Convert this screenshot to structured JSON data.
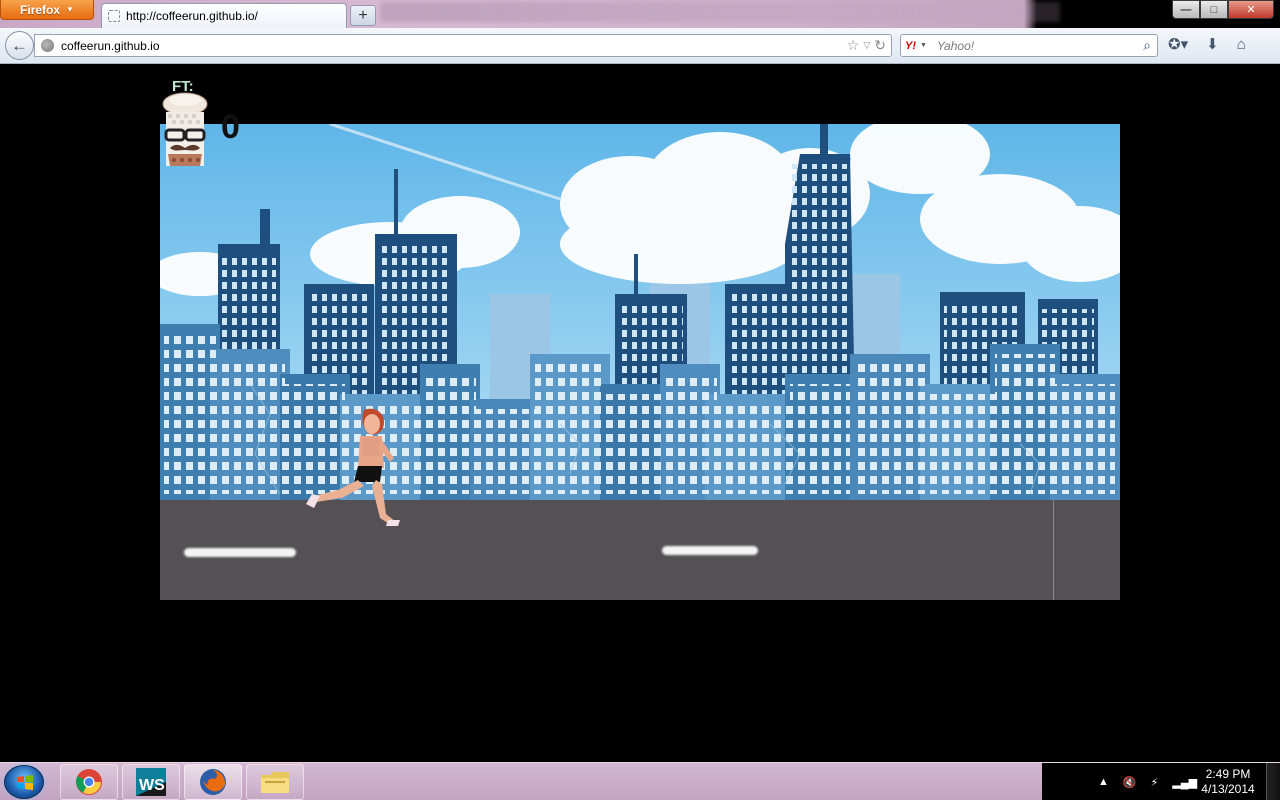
{
  "browser": {
    "app_button_label": "Firefox",
    "tab_title": "http://coffeerun.github.io/",
    "new_tab_label": "+",
    "url": "coffeerun.github.io",
    "search_engine_logo": "Y!",
    "search_placeholder": "Yahoo!",
    "window_controls": {
      "minimize": "—",
      "maximize": "□",
      "close": "✕"
    }
  },
  "game": {
    "hud_label": "FT:",
    "score": "0"
  },
  "taskbar": {
    "apps": [
      {
        "name": "chrome-icon"
      },
      {
        "name": "webstorm-icon",
        "label": "WS"
      },
      {
        "name": "firefox-icon"
      },
      {
        "name": "file-explorer-icon"
      }
    ],
    "clock_time": "2:49 PM",
    "clock_date": "4/13/2014"
  },
  "colors": {
    "sky_top": "#5fb6e8",
    "road": "#545054",
    "building_dark": "#1f4f7f",
    "building_mid": "#3f7fb0",
    "building_light": "#6aa6d2",
    "firefox_orange": "#e86b10"
  }
}
